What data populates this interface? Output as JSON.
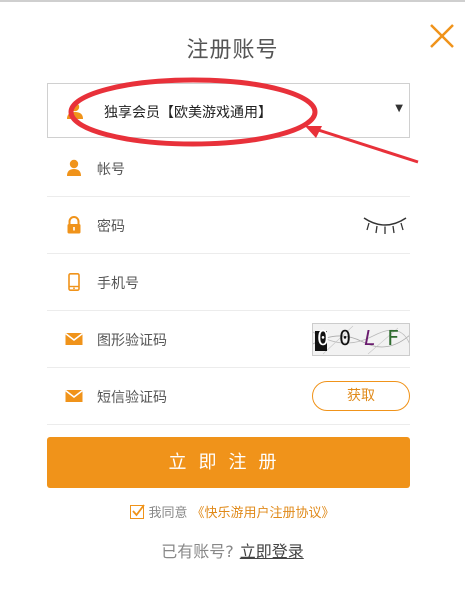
{
  "page": {
    "title": "注册账号"
  },
  "account_type": {
    "selected": "独享会员【欧美游戏通用】"
  },
  "fields": {
    "account_label": "帐号",
    "password_label": "密码",
    "phone_label": "手机号",
    "captcha_label": "图形验证码",
    "sms_label": "短信验证码"
  },
  "captcha": {
    "chars": [
      "0",
      "0",
      "L",
      "F"
    ]
  },
  "buttons": {
    "get_code": "获取",
    "submit": "立即注册",
    "login_link": "立即登录"
  },
  "agreement": {
    "prefix": "我同意",
    "link": "《快乐游用户注册协议》"
  },
  "login_prompt": {
    "text": "已有账号?"
  },
  "colors": {
    "accent": "#f0931a",
    "annotation_red": "#e8313a"
  }
}
